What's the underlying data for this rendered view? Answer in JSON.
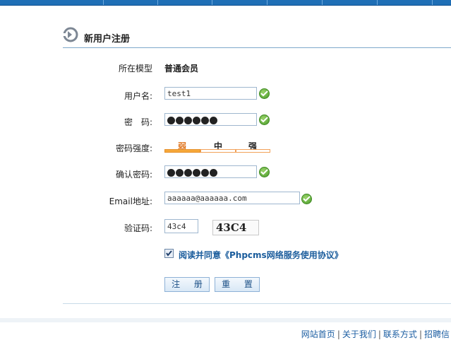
{
  "header": {
    "title": "新用户注册"
  },
  "form": {
    "model_label": "所在模型",
    "model_value": "普通会员",
    "username_label": "用户名:",
    "username_value": "test1",
    "password_label": "密　码:",
    "strength_label": "密码强度:",
    "strength": {
      "weak": "弱",
      "medium": "中",
      "strong": "强"
    },
    "confirm_label": "确认密码:",
    "email_label": "Email地址:",
    "email_value": "aaaaaa@aaaaaa.com",
    "captcha_label": "验证码:",
    "captcha_value": "43c4",
    "captcha_image_text": "43C4",
    "agree_text": "阅读并同意《Phpcms网络服务使用协议》",
    "agree_checked": true,
    "submit_label": "注 册",
    "reset_label": "重 置"
  },
  "footer": {
    "links": [
      "网站首页",
      "关于我们",
      "联系方式",
      "招聘信"
    ]
  },
  "colors": {
    "accent": "#1f6fb6",
    "link": "#1a5c9c",
    "ok": "#4a9a2a",
    "strength_active": "#f29a2e"
  },
  "icons": {
    "header": "arrow-icon",
    "valid": "check-icon"
  }
}
